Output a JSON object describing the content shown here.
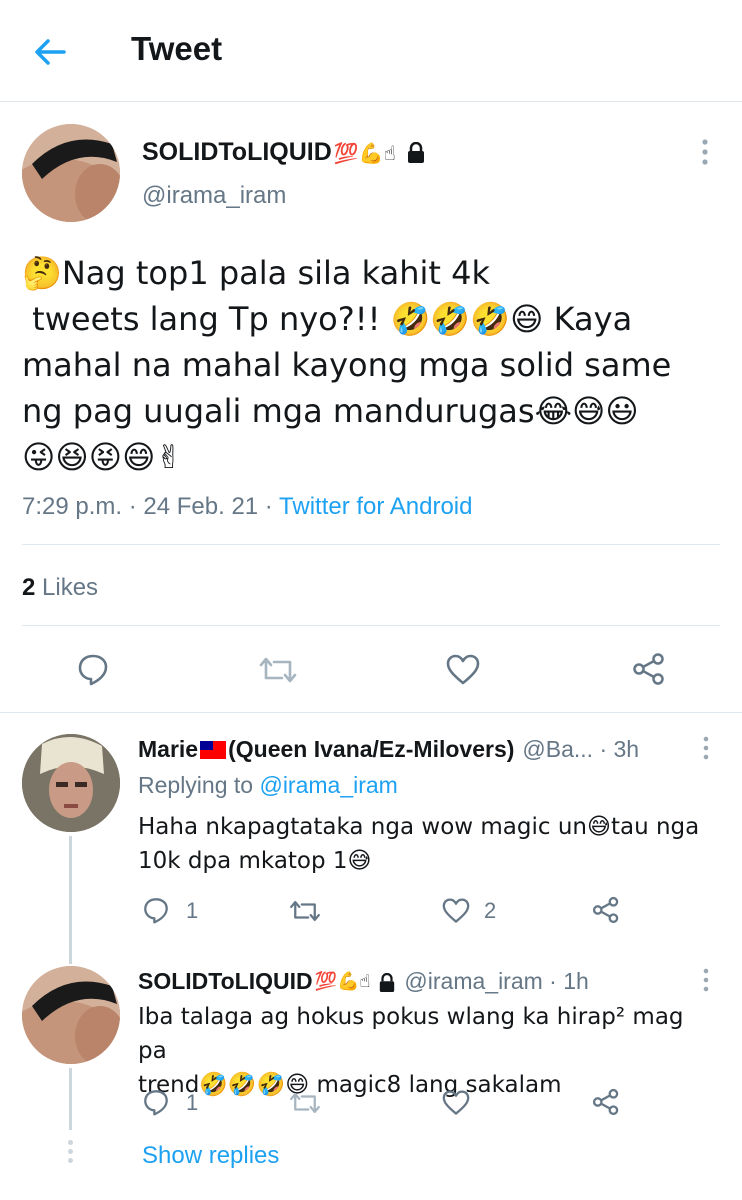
{
  "header": {
    "title": "Tweet",
    "back_icon": "arrow-left-icon"
  },
  "colors": {
    "accent": "#1da1f2",
    "text": "#14171a",
    "muted": "#657786",
    "divider": "#e1e8ed"
  },
  "main_tweet": {
    "display_name": "SOLIDToLIQUID",
    "name_emojis": "💯💪☝",
    "lock_icon": "lock-icon",
    "handle": "@irama_iram",
    "text_lines": [
      "🤔Nag top1 pala sila kahit 4k",
      " tweets lang Tp nyo?!! 🤣🤣🤣😄 Kaya",
      "mahal na mahal kayong mga solid same",
      "ng pag uugali mga mandurugas😂😅😃",
      "😜😆😝😄✌"
    ],
    "time": "7:29 p.m.",
    "sep1": " · ",
    "date": "24 Feb. 21",
    "sep2": " · ",
    "source": "Twitter for Android",
    "likes_count": "2",
    "likes_label": " Likes",
    "actions": [
      "reply-icon",
      "retweet-icon",
      "like-icon",
      "share-icon"
    ]
  },
  "replies": [
    {
      "name_prefix": "Marie",
      "name_suffix": "(Queen Ivana/Ez-Milovers)",
      "handle": "@Ba...",
      "time": " · 3h",
      "replying_to_label": "Replying to ",
      "replying_to_handle": "@irama_iram",
      "text_line1": "Haha nkapagtataka nga wow magic un😅tau nga",
      "text_line2": "10k dpa mkatop 1😅",
      "reply_count": "1",
      "retweet_count": "",
      "like_count": "2"
    },
    {
      "display_name": "SOLIDToLIQUID",
      "name_emojis": "💯💪☝",
      "handle": "@irama_iram",
      "time": " · 1h",
      "text_line1": "Iba talaga ag hokus pokus wlang ka hirap² mag pa",
      "text_line2": "trend🤣🤣🤣😄 magic8 lang sakalam",
      "reply_count": "1",
      "retweet_count": "",
      "like_count": ""
    }
  ],
  "show_replies": "Show replies"
}
